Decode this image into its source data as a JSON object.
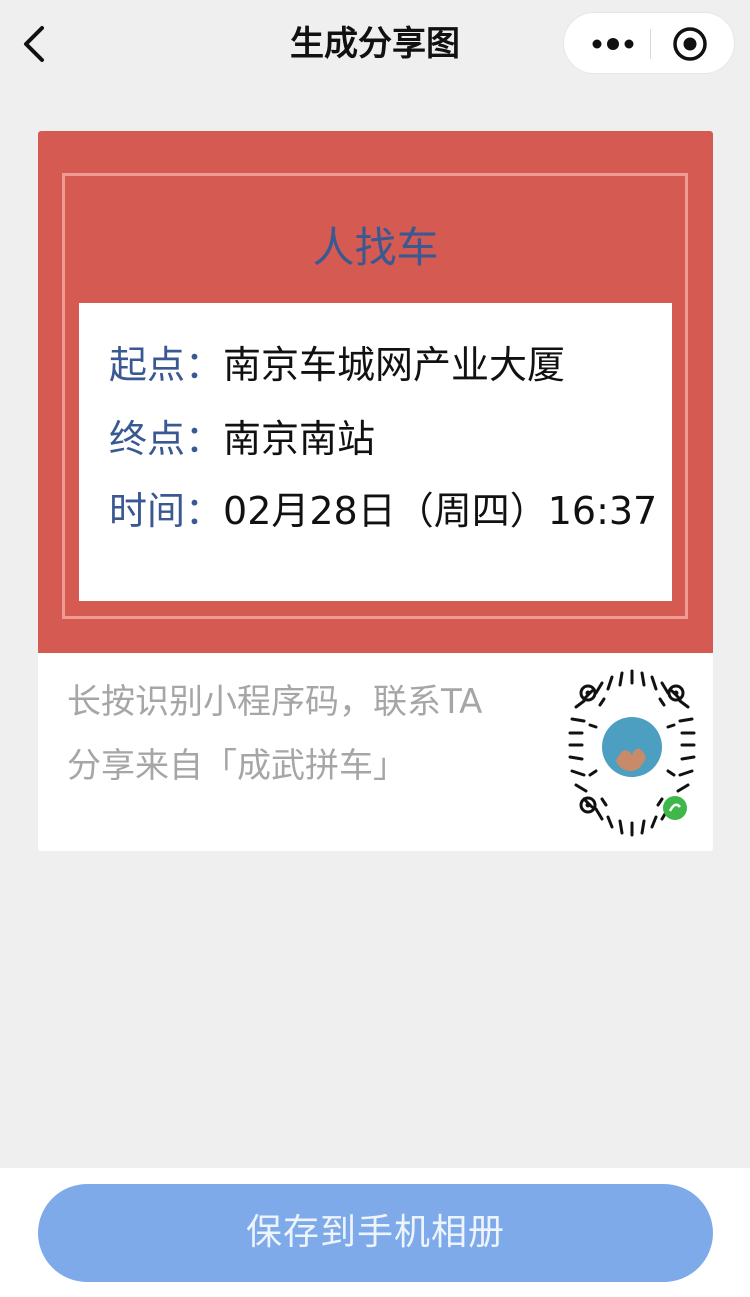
{
  "nav": {
    "title": "生成分享图"
  },
  "card": {
    "title": "人找车",
    "rows": [
      {
        "label": "起点：",
        "value": "南京车城网产业大厦"
      },
      {
        "label": "终点：",
        "value": "南京南站"
      },
      {
        "label": "时间：",
        "value": "02月28日（周四）16:37"
      }
    ],
    "footer_line1": "长按识别小程序码，联系TA",
    "footer_line2": "分享来自「成武拼车」"
  },
  "actions": {
    "save_label": "保存到手机相册"
  },
  "colors": {
    "card_red": "#d55b52",
    "label_blue": "#3a5891",
    "button_blue": "#7faaea",
    "page_bg": "#efefef"
  },
  "icons": [
    "back-arrow-icon",
    "more-dots-icon",
    "target-icon",
    "mini-program-code-icon"
  ]
}
